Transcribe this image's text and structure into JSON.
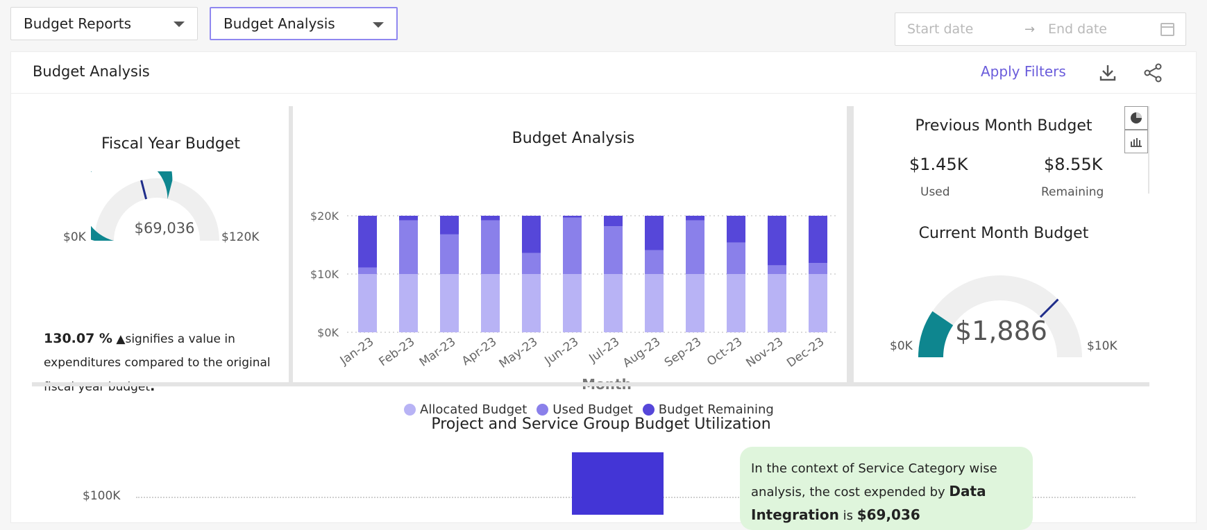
{
  "topbar": {
    "report_select": "Budget Reports",
    "analysis_select": "Budget Analysis",
    "start_placeholder": "Start date",
    "end_placeholder": "End date",
    "arrow": "→"
  },
  "panel": {
    "title": "Budget Analysis",
    "apply_filters": "Apply Filters"
  },
  "fiscal": {
    "title": "Fiscal Year Budget",
    "value": "$69,036",
    "min_label": "$0K",
    "max_label": "$120K",
    "fill_fraction": 0.58,
    "marker_fraction": 0.42,
    "note_pct": "130.07 %",
    "note_arrow": "▲",
    "note_text_1": "signifies a value in",
    "note_text_2": "expenditures compared to the original",
    "note_text_3": "fiscal year budget",
    "note_end": "."
  },
  "chart_data": {
    "type": "bar",
    "title": "Budget Analysis",
    "xlabel": "Month",
    "ylabel": "",
    "ylim": [
      0,
      20000
    ],
    "yticks": [
      "$0K",
      "$10K",
      "$20K"
    ],
    "stacked": true,
    "categories": [
      "Jan-23",
      "Feb-23",
      "Mar-23",
      "Apr-23",
      "May-23",
      "Jun-23",
      "Jul-23",
      "Aug-23",
      "Sep-23",
      "Oct-23",
      "Nov-23",
      "Dec-23"
    ],
    "series": [
      {
        "name": "Allocated Budget",
        "color": "#b8b3f5",
        "values": [
          10000,
          10000,
          10000,
          10000,
          10000,
          10000,
          10000,
          10000,
          10000,
          10000,
          10000,
          10000
        ]
      },
      {
        "name": "Used Budget",
        "color": "#8a80ea",
        "values": [
          1100,
          9200,
          6800,
          9200,
          3600,
          9700,
          8200,
          4100,
          9200,
          5400,
          1500,
          1900
        ]
      },
      {
        "name": "Budget Remaining",
        "color": "#5647d9",
        "values": [
          8900,
          800,
          3200,
          800,
          6400,
          300,
          1800,
          5900,
          800,
          4600,
          8500,
          8100
        ]
      }
    ],
    "grid": true,
    "legend_position": "bottom"
  },
  "prev_month": {
    "title": "Previous Month Budget",
    "used_value": "$1.45K",
    "used_label": "Used",
    "remaining_value": "$8.55K",
    "remaining_label": "Remaining"
  },
  "current_month": {
    "title": "Current Month Budget",
    "value": "$1,886",
    "min_label": "$0K",
    "max_label": "$10K",
    "fill_fraction": 0.19,
    "marker_fraction": 0.75
  },
  "bottom": {
    "title": "Project and Service Group Budget Utilization",
    "ytick": "$100K",
    "bar_color": "#4335d6",
    "callout_1": "In the context of Service Category wise",
    "callout_2": "analysis, the cost expended by ",
    "callout_bold": "Data",
    "callout_3": "Integration",
    "callout_4": " is ",
    "callout_value": "$69,036"
  },
  "colors": {
    "teal": "#0e868f",
    "gauge_bg": "#efefef",
    "marker": "#1f2d8a",
    "accent": "#6a5cdb"
  },
  "icons": {
    "download": "download-icon",
    "share": "share-icon",
    "pie": "pie-chart-icon",
    "bar": "bar-chart-icon",
    "calendar": "calendar-icon",
    "caret": "chevron-down-icon"
  }
}
